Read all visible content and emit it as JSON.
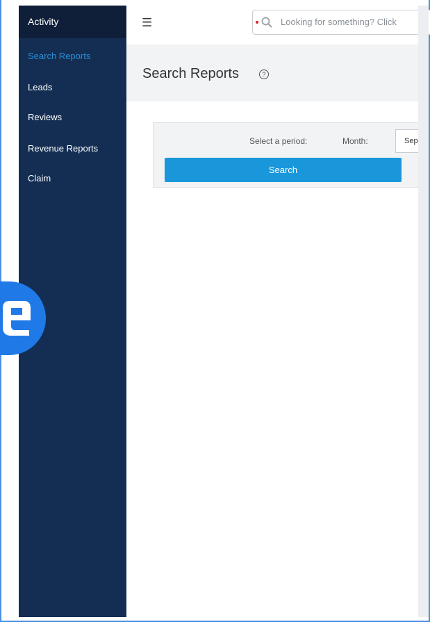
{
  "sidebar": {
    "top_label": "Activity",
    "items": [
      {
        "label": "Search Reports",
        "active": true
      },
      {
        "label": "Leads"
      },
      {
        "label": "Reviews"
      },
      {
        "label": "Revenue Reports"
      },
      {
        "label": "Claim"
      }
    ]
  },
  "topbar": {
    "menu_icon": "hamburger-icon",
    "search": {
      "placeholder": "Looking for something? Click",
      "icon": "search-icon"
    }
  },
  "page": {
    "title": "Search Reports",
    "help_icon": "help-icon"
  },
  "filters": {
    "period_label": "Select a period:",
    "month_label": "Month:",
    "month_value": "Sep",
    "search_button": "Search"
  },
  "colors": {
    "sidebar_bg": "#142e53",
    "active_item": "#2a8ed4",
    "primary_button": "#1a97db",
    "logo_badge": "#1f7ae8"
  }
}
